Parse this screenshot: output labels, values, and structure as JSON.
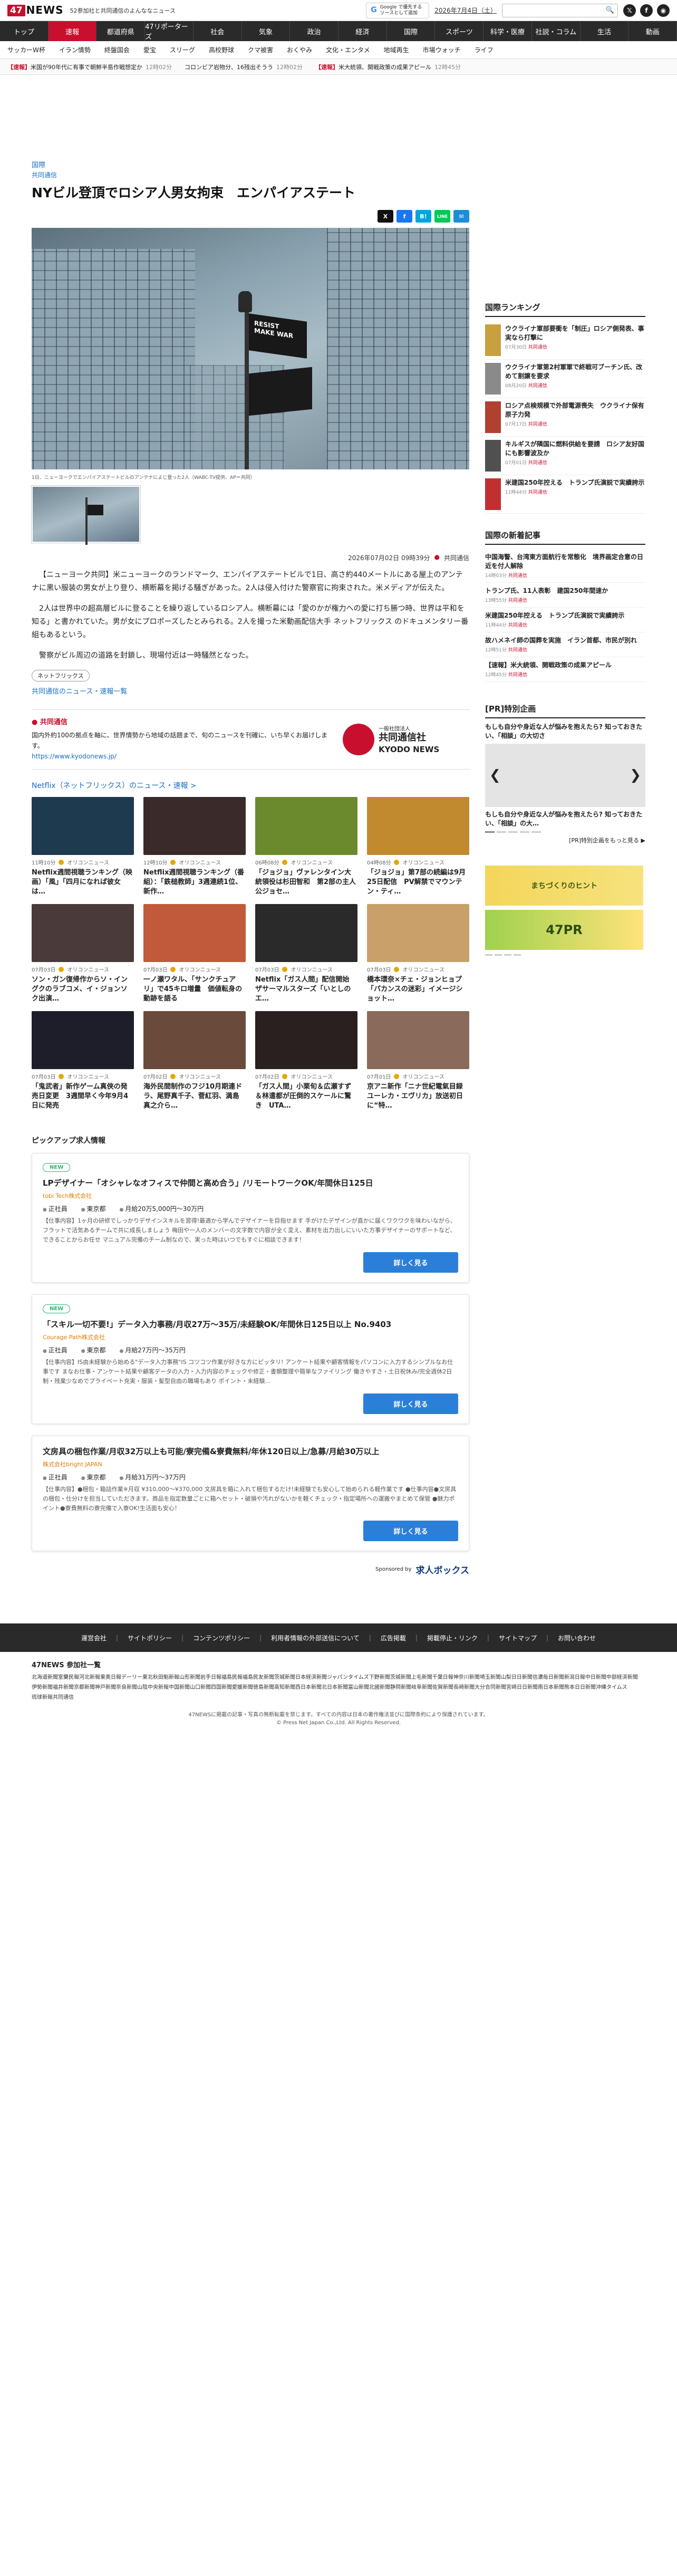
{
  "header": {
    "logo_num": "47",
    "logo_word": "NEWS",
    "tagline": "52参加社と共同通信のよんななニュース",
    "google_line1": "Google で優先する",
    "google_line2": "ソースとして追加",
    "date": "2026年7月4日（土）",
    "search_icon": "🔍",
    "social": [
      "𝕏",
      "f",
      "◉"
    ]
  },
  "nav": [
    "トップ",
    "速報",
    "都道府県",
    "47リポーターズ",
    "社会",
    "気象",
    "政治",
    "経済",
    "国際",
    "スポーツ",
    "科学・医療",
    "社説・コラム",
    "生活",
    "動画"
  ],
  "nav_active": 1,
  "subnav": [
    "サッカーW杯",
    "イラン情勢",
    "終盤国会",
    "愛宝",
    "スリーグ",
    "高校野球",
    "クマ被害",
    "おくやみ",
    "文化・エンタメ",
    "地域再生",
    "市場ウォッチ",
    "ライフ"
  ],
  "ticker": [
    {
      "tag": "【速報】",
      "text": "米国が90年代に有事で朝鮮半島作戦想定か",
      "time": "12時02分"
    },
    {
      "tag": "",
      "text": "コロンビア岩物分、16残出そうう",
      "time": "12時02分"
    },
    {
      "tag": "【速報】",
      "text": "米大統領、開戦政策の成果アピール",
      "time": "12時45分"
    }
  ],
  "article": {
    "crumb1": "国際",
    "crumb2": "共同通信",
    "title": "NYビル登頂でロシア人男女拘束　エンパイアステート",
    "share": [
      "X",
      "f",
      "B!",
      "LINE",
      "✉"
    ],
    "flag_text": "RESIST MAKE WAR",
    "caption": "1日、ニューヨークでエンパイアステートビルのアンテナによじ登った2人（WABC-TV提供、AP＝共同）",
    "timestamp": "2026年07月02日 09時39分",
    "source": "共同通信",
    "paragraphs": [
      "【ニューヨーク共同】米ニューヨークのランドマーク、エンパイアステートビルで1日、高さ約440メートルにある屋上のアンテナに黒い服装の男女が上り登り、横断幕を掲げる騒ぎがあった。2人は侵入付けた警察官に拘束された。米メディアが伝えた。",
      "2人は世界中の超高層ビルに登ることを繰り返しているロシア人。横断幕には「愛のかが権力への愛に打ち勝つ時、世界は平和を知る」と書かれていた。男が女にプロポーズしたとみられる。2人を撮った米動画配信大手 ネットフリックス のドキュメンタリー番組もあるという。",
      "警察がビル周辺の道路を封鎖し、現場付近は一時騒然となった。"
    ],
    "tag": "ネットフリックス",
    "more_link": "共同通信のニュース・速報一覧"
  },
  "kyodo": {
    "heading": "共同通信",
    "desc": "国内外約100の拠点を軸に、世界情勢から地域の話題まで、旬のニュースを刊確に、いち早くお届けします。",
    "url": "https://www.kyodonews.jp/",
    "logo_small": "一般社団法人",
    "logo_main": "共同通信社",
    "logo_en": "KYODO NEWS"
  },
  "netflix": {
    "heading": "Netflix（ネットフリックス）のニュース・速報 >",
    "items": [
      {
        "date": "11時10分",
        "src": "オリコンニュース",
        "title": "Netflix週間視聴ランキング（映画）「風」「四月になれば彼女は…",
        "color": "#1d3a4f"
      },
      {
        "date": "12時10分",
        "src": "オリコンニュース",
        "title": "Netflix週間視聴ランキング（番組）：「鉄槌教師」3週連続1位、新作…",
        "color": "#3a2a2a"
      },
      {
        "date": "06時08分",
        "src": "オリコンニュース",
        "title": "「ジョジョ」ヴァレンタイン大統領役は杉田智和　第2部の主人公ジョセ…",
        "color": "#6b8a2e"
      },
      {
        "date": "04時08分",
        "src": "オリコンニュース",
        "title": "「ジョジョ」第7部の続編は9月25日配信　PV解禁でマウンテン・ティ…",
        "color": "#c28a2e"
      },
      {
        "date": "07月03日",
        "src": "オリコンニュース",
        "title": "ソン・ガン復帰作からソ・イングクのラブコメ、イ・ジョンソク出演…",
        "color": "#4a3a3a"
      },
      {
        "date": "07月03日",
        "src": "オリコンニュース",
        "title": "一ノ瀬ワタル、「サンクチュアリ」で45キロ増量　価値転身の動跡を語る",
        "color": "#c05a3a"
      },
      {
        "date": "07月03日",
        "src": "オリコンニュース",
        "title": "Netflix「ガス人間」配信開始　ザサーマルスターズ「いとしのエ…",
        "color": "#2a2a2a"
      },
      {
        "date": "07月03日",
        "src": "オリコンニュース",
        "title": "橋本環奈×チェ・ジョンヒョプ「パカンスの迷彩」イメージショット…",
        "color": "#c9a06a"
      },
      {
        "date": "07月03日",
        "src": "オリコンニュース",
        "title": "「鬼武者」新作ゲーム真俠の発売日変更　3週間早く今年9月4日に発売",
        "color": "#1e1e2a"
      },
      {
        "date": "07月02日",
        "src": "オリコンニュース",
        "title": "海外民間制作のフジ10月期連ドラ、尾野真千子、菅紅羽、満島真之介ら…",
        "color": "#6a4a3a"
      },
      {
        "date": "07月02日",
        "src": "オリコンニュース",
        "title": "「ガス人間」小栗旬＆広瀬すず＆林遣都が圧倒的スケールに驚き　UTA…",
        "color": "#2a2020"
      },
      {
        "date": "07月01日",
        "src": "オリコンニュース",
        "title": "京アニ新作「ニナ世紀電氣目録 ユーレカ・エヴリカ」放送初日に“特…",
        "color": "#8a6a5a"
      }
    ]
  },
  "jobs": {
    "heading": "ピックアップ求人情報",
    "items": [
      {
        "badge": "NEW",
        "title": "LPデザイナー「オシャレなオフィスで仲間と高め合う」/リモートワークOK/年間休日125日",
        "company": "tobi Tech株式会社",
        "type": "正社員",
        "loc": "東京都",
        "salary": "月給20万5,000円〜30万円",
        "desc": "【仕事内容】1ヶ月の研修でしっかりデザインスキルを習得!最適から学んでデザイナーを目指せます 手がけたデザインが直かに届くワクワクを味わいながら、フラットで活気あるチームで共に成長しましょう 梅田や一人のメンバーの文字数で内容が全く変え、素材を出力出しにいいた方事デザイナーのサポートなど、できることからお任せ マニュアル完備のチーム制なので、実った時はいつでもすぐに相談できます！",
        "button": "詳しく見る"
      },
      {
        "badge": "NEW",
        "title": "「スキル一切不要!」データ入力事務/月収27万〜35万/未経験OK/年間休日125日以上 No.9403",
        "company": "Courage Path株式会社",
        "type": "正社員",
        "loc": "東京都",
        "salary": "月給27万円〜35万円",
        "desc": "【仕事内容】IS由未経験から始める\"データ入力事務\"IS コツコツ作業が好きな方にピッタリ! アンケート結果や顧客情報をパソコンに入力するシンプルなお仕事です まなお仕事・アンケート結果や顧客データの入力・入力内容のチェックや修正・書類整理や簡単なファイリング 働きやすさ・土日祝休み/完全週休2日制・残業少なめでプライベート充実・服装・髪型自由の職場もあり ポイント・未経験…",
        "button": "詳しく見る"
      },
      {
        "badge": "",
        "title": "文房具の梱包作業/月収32万以上も可能/寮完備&寮費無料/年休120日以上/急募/月給30万以上",
        "company": "株式会社bright JAPAN",
        "type": "正社員",
        "loc": "東京都",
        "salary": "月給31万円〜37万円",
        "desc": "【仕事内容】●梱包・箱詰作業※月収 ¥310,000〜¥370,000 文房具を箱に入れて梱包するだけ!未経験でも安心して始められる軽作業です ●仕事内容●文房具の梱包・仕分けを担当していただきます。商品を指定数量ごとに箱へセット・破損や汚れがないかを軽くチェック・指定場所への運搬やまとめて保管 ●魅力ポイント●寮費無料の寮完備で入寮OK!生活面も安心！",
        "button": "詳しく見る"
      }
    ],
    "sponsor_label": "Sponsored by",
    "sponsor_name": "求人ボックス"
  },
  "sidebar": {
    "ranking_h": "国際ランキング",
    "ranking": [
      {
        "title": "ウクライナ軍部要衝を「制圧」ロシア側発表、事実なら打撃に",
        "time": "07月30日",
        "src": "共同通信",
        "color": "#c9a040"
      },
      {
        "title": "ウクライナ軍第2村軍軍で終戦可ブーチン氏、改めて割譲を要求",
        "time": "08月20日",
        "src": "共同通信",
        "color": "#8a8a8a"
      },
      {
        "title": "ロシア点検規模で外部電源喪失　ウクライナ保有原子力発",
        "time": "07月17日",
        "src": "共同通信",
        "color": "#b04030"
      },
      {
        "title": "キルギスが隣国に燃料供給を要請　ロシア友好国にも影響波及か",
        "time": "07月01日",
        "src": "共同通信",
        "color": "#505050"
      },
      {
        "title": "米建国250年控える　トランプ氏演説で実績誇示",
        "time": "11時44分",
        "src": "共同通信",
        "color": "#c03030"
      }
    ],
    "new_h": "国際の新着記事",
    "news": [
      {
        "title": "中国海警、台湾東方面航行を常態化　境界画定合意の日近を付人解除",
        "time": "14時03分",
        "src": "共同通信"
      },
      {
        "title": "トランプ氏、11人表彰　建国250年間速か",
        "time": "13時55分",
        "src": "共同通信"
      },
      {
        "title": "米建国250年控える　トランプ氏演説で実績誇示",
        "time": "11時44分",
        "src": "共同通信"
      },
      {
        "title": "故ハメネイ師の国葬を実施　イラン首都、市民が別れ",
        "time": "12時51分",
        "src": "共同通信"
      },
      {
        "title": "【速報】米大統領、開戦政策の成果アピール",
        "time": "12時45分",
        "src": "共同通信"
      }
    ],
    "pr_h": "[PR]特別企画",
    "pr_top": "もしも自分や身近な人が悩みを抱えたら? 知っておきたい、「相談」の大切さ",
    "pr_caption": "もしも自分や身近な人が悩みを抱えたら? 知っておきたい、「相談」の大…",
    "pr_more": "[PR]特別企画をもっと見る ▶",
    "banner1": "まちづくりのヒント",
    "banner2": "47PR"
  },
  "footer": {
    "links": [
      "運営会社",
      "サイトポリシー",
      "コンテンツポリシー",
      "利用者情報の外部送信について",
      "広告掲載",
      "掲載停止・リンク",
      "サイトマップ",
      "お問い合わせ"
    ],
    "papers_h": "47NEWS 参加社一覧",
    "papers": [
      "北海道新聞",
      "室蘭民報",
      "河北新報",
      "東奥日報",
      "デーリー東北",
      "秋田魁新報",
      "山形新聞",
      "岩手日報",
      "福島民報",
      "福島民友新聞",
      "茨城新聞",
      "日本経済新聞",
      "ジャパンタイムズ",
      "下野新聞",
      "茨城新聞",
      "上毛新聞",
      "千葉日報",
      "神奈川新聞",
      "埼玉新聞",
      "山梨日日新聞",
      "信濃毎日新聞",
      "新潟日報",
      "中日新聞",
      "中部経済新聞",
      "伊勢新聞",
      "福井新聞",
      "京都新聞",
      "神戸新聞",
      "奈良新聞",
      "山陰中央新報",
      "中国新聞",
      "山口新聞",
      "四国新聞",
      "愛媛新聞",
      "徳島新聞",
      "高知新聞",
      "西日本新聞",
      "北日本新聞",
      "富山新聞",
      "北國新聞",
      "静岡新聞",
      "岐阜新聞",
      "佐賀新聞",
      "長崎新聞",
      "大分合同新聞",
      "宮崎日日新聞",
      "南日本新聞",
      "熊本日日新聞",
      "沖縄タイムス",
      "琉球新報",
      "共同通信"
    ],
    "note": "47NEWSに掲載の記事・写真の無断転載を禁じます。すべての内容は日本の著作権法並びに国際条約により保護されています。",
    "copy": "© Press Net Japan Co.,Ltd. All Rights Reserved."
  }
}
